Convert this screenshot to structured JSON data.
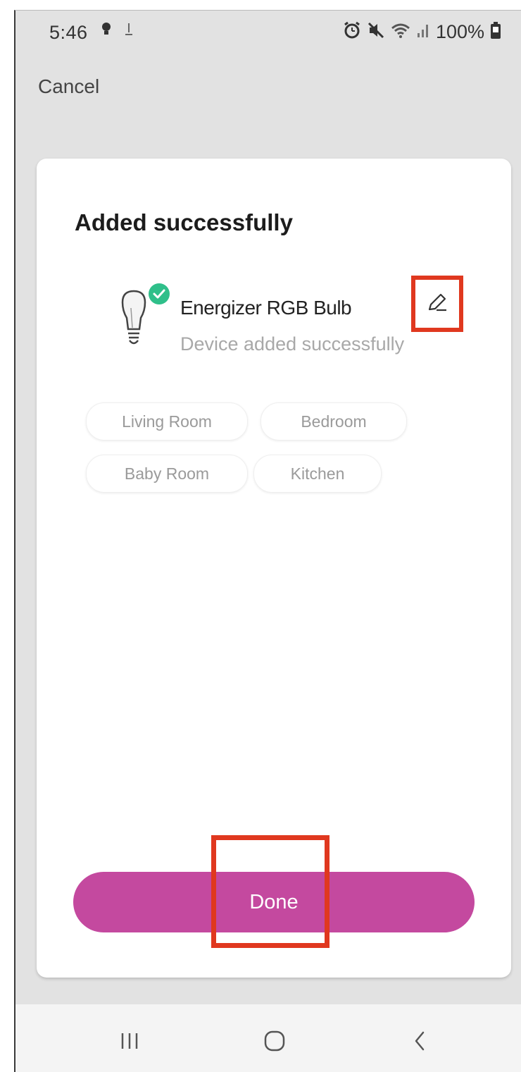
{
  "status_bar": {
    "time": "5:46",
    "battery": "100%",
    "icons_left": [
      "lightbulb-icon",
      "download-icon"
    ],
    "icons_right": [
      "alarm-icon",
      "mute-icon",
      "wifi-icon",
      "signal-icon",
      "battery-icon"
    ]
  },
  "header": {
    "cancel_label": "Cancel"
  },
  "card": {
    "title": "Added successfully",
    "device": {
      "name": "Energizer RGB Bulb",
      "status": "Device added successfully",
      "icon": "lightbulb-icon",
      "check_badge_color": "#2fbf8a"
    },
    "rooms": [
      "Living Room",
      "Bedroom",
      "Baby Room",
      "Kitchen"
    ],
    "done_label": "Done"
  },
  "nav": {
    "buttons": [
      "recent-apps-icon",
      "home-icon",
      "back-icon"
    ]
  },
  "colors": {
    "accent": "#c4499f",
    "highlight": "#e0381f",
    "background": "#e2e2e2"
  }
}
